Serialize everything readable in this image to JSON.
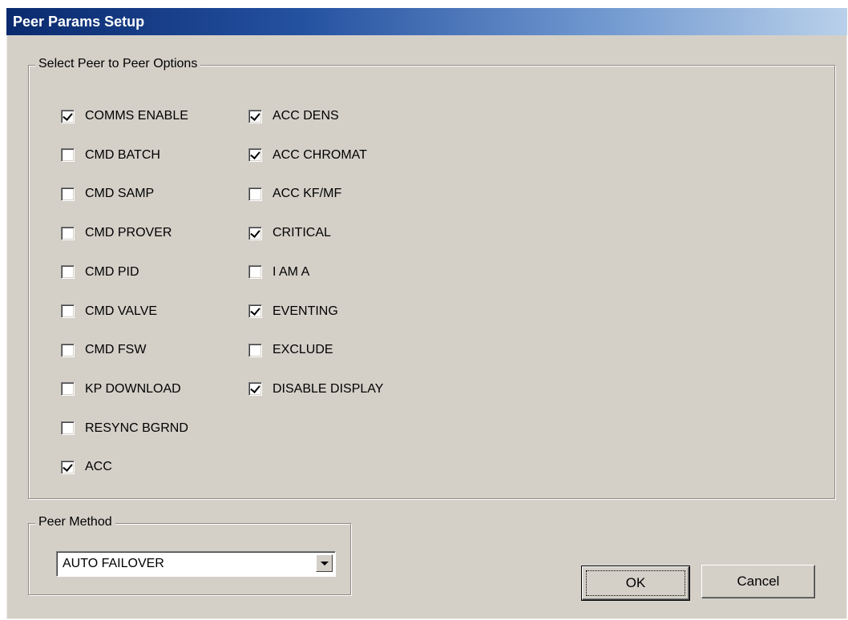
{
  "window": {
    "title": "Peer Params Setup"
  },
  "options_group": {
    "label": "Select Peer to Peer Options",
    "left_column": [
      {
        "label": "COMMS ENABLE",
        "checked": true
      },
      {
        "label": "CMD BATCH",
        "checked": false
      },
      {
        "label": "CMD SAMP",
        "checked": false
      },
      {
        "label": "CMD PROVER",
        "checked": false
      },
      {
        "label": "CMD PID",
        "checked": false
      },
      {
        "label": "CMD VALVE",
        "checked": false
      },
      {
        "label": "CMD FSW",
        "checked": false
      },
      {
        "label": "KP DOWNLOAD",
        "checked": false
      },
      {
        "label": "RESYNC BGRND",
        "checked": false
      },
      {
        "label": "ACC",
        "checked": true
      }
    ],
    "right_column": [
      {
        "label": "ACC DENS",
        "checked": true
      },
      {
        "label": "ACC CHROMAT",
        "checked": true
      },
      {
        "label": "ACC KF/MF",
        "checked": false
      },
      {
        "label": "CRITICAL",
        "checked": true
      },
      {
        "label": "I AM A",
        "checked": false
      },
      {
        "label": "EVENTING",
        "checked": true
      },
      {
        "label": "EXCLUDE",
        "checked": false
      },
      {
        "label": "DISABLE DISPLAY",
        "checked": true
      }
    ]
  },
  "method_group": {
    "label": "Peer Method",
    "selected": "AUTO FAILOVER"
  },
  "buttons": {
    "ok": "OK",
    "cancel": "Cancel"
  }
}
